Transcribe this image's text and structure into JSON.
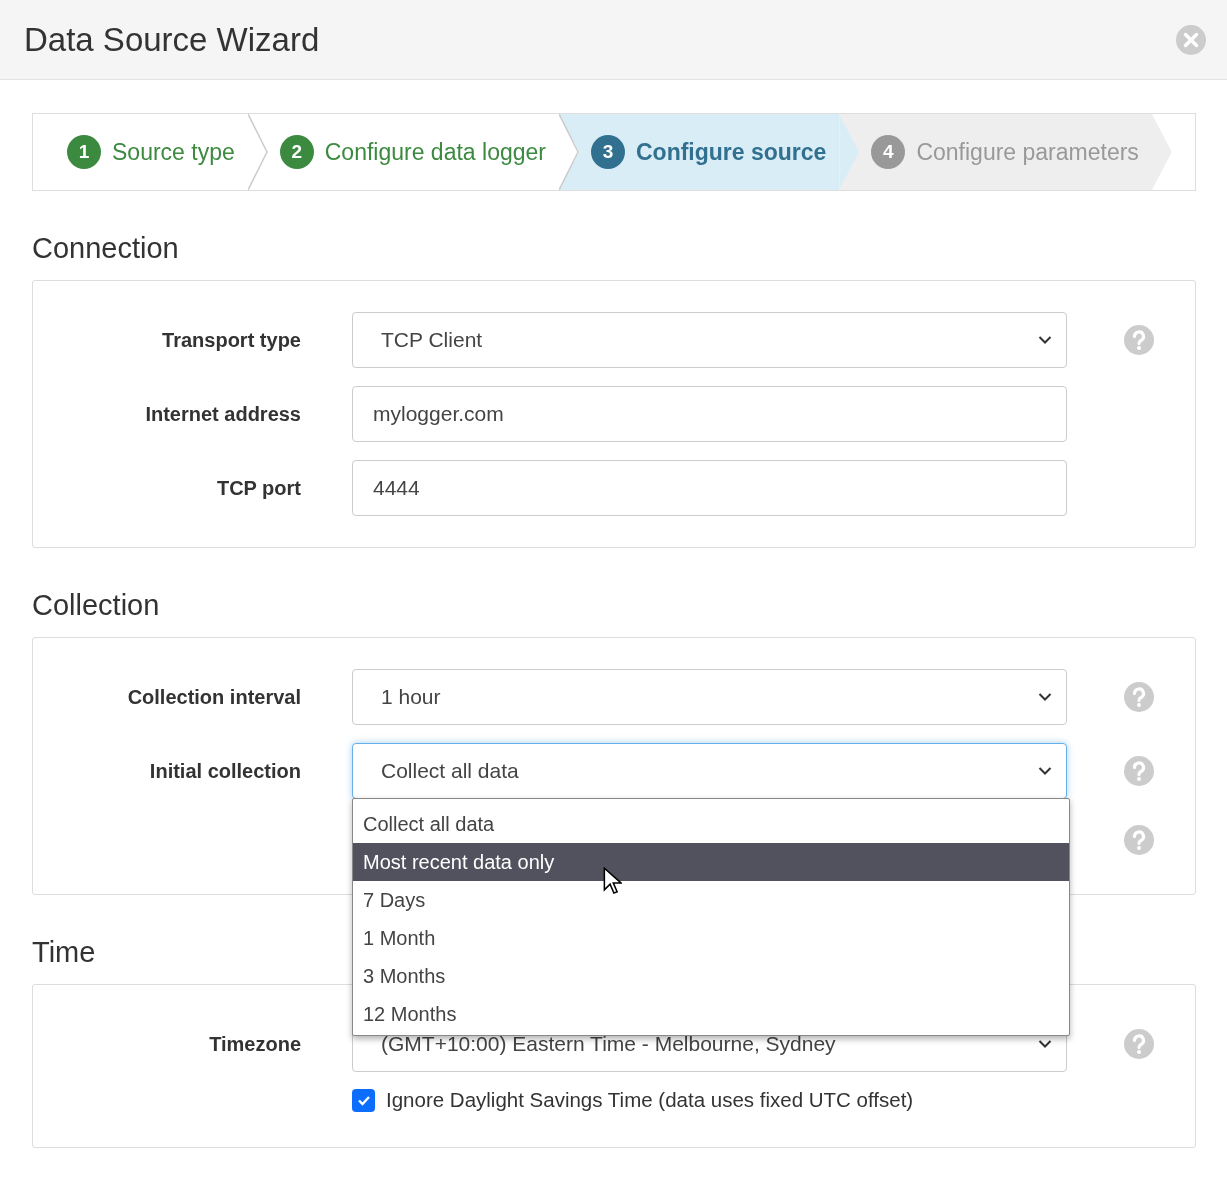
{
  "window": {
    "title": "Data Source Wizard"
  },
  "steps": [
    {
      "number": "1",
      "label": "Source type",
      "completed": true,
      "selected": false
    },
    {
      "number": "2",
      "label": "Configure data logger",
      "completed": true,
      "selected": false
    },
    {
      "number": "3",
      "label": "Configure source",
      "completed": false,
      "selected": true
    },
    {
      "number": "4",
      "label": "Configure parameters",
      "completed": false,
      "selected": false
    }
  ],
  "sections": [
    {
      "title": "Connection",
      "fields": [
        {
          "kind": "select",
          "label": "Transport type",
          "value": "TCP Client",
          "help": true,
          "focused": false
        },
        {
          "kind": "text",
          "label": "Internet address",
          "value": "mylogger.com",
          "help": false,
          "focused": false
        },
        {
          "kind": "text",
          "label": "TCP port",
          "value": "4444",
          "help": false,
          "focused": false
        }
      ]
    },
    {
      "title": "Collection",
      "fields": [
        {
          "kind": "select",
          "label": "Collection interval",
          "value": "1 hour",
          "help": true,
          "focused": false
        },
        {
          "kind": "select",
          "label": "Initial collection",
          "value": "Collect all data",
          "help": true,
          "focused": true,
          "options": [
            {
              "label": "Collect all data",
              "highlighted": false
            },
            {
              "label": "Most recent data only",
              "highlighted": true
            },
            {
              "label": "7 Days",
              "highlighted": false
            },
            {
              "label": "1 Month",
              "highlighted": false
            },
            {
              "label": "3 Months",
              "highlighted": false
            },
            {
              "label": "12 Months",
              "highlighted": false
            }
          ]
        },
        {
          "kind": "hidden",
          "help": true
        }
      ]
    },
    {
      "title": "Time",
      "fields": [
        {
          "kind": "select",
          "label": "Timezone",
          "value": "(GMT+10:00) Eastern Time - Melbourne, Sydney",
          "help": true,
          "focused": false
        },
        {
          "kind": "checkbox",
          "label": "Ignore Daylight Savings Time (data uses fixed UTC offset)",
          "checked": true
        }
      ]
    }
  ]
}
